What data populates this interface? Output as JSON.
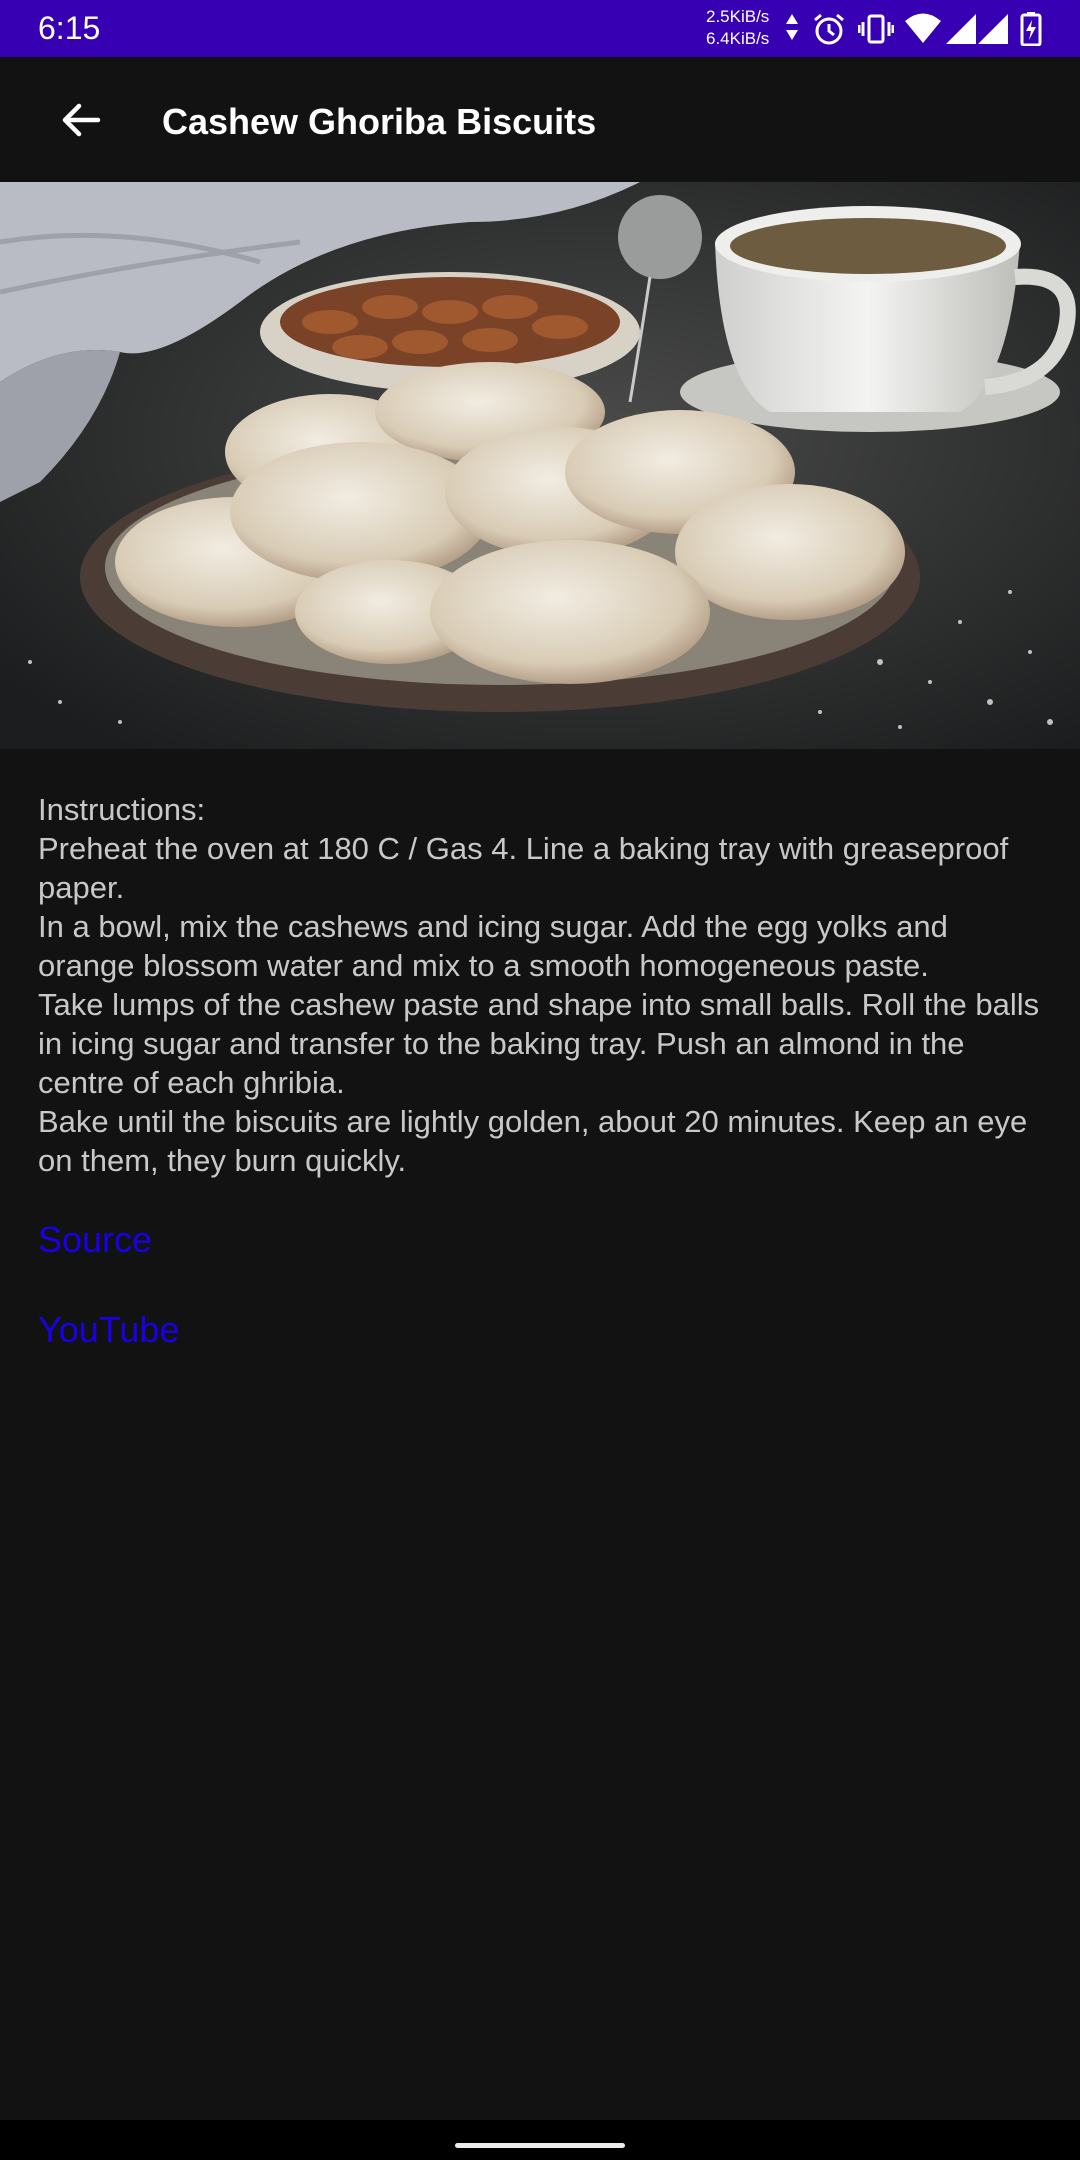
{
  "status_bar": {
    "time": "6:15",
    "upload_speed": "2.5KiB/s",
    "download_speed": "6.4KiB/s",
    "background_color": "#3700b3",
    "icons": [
      "data-arrows-icon",
      "alarm-icon",
      "vibrate-icon",
      "wifi-icon",
      "signal-icon",
      "signal-icon",
      "battery-charging-icon"
    ]
  },
  "app_bar": {
    "title": "Cashew Ghoriba Biscuits",
    "back_icon": "arrow-back-icon"
  },
  "recipe": {
    "instructions": "Instructions:\nPreheat the oven at 180 C / Gas 4. Line a baking tray with greaseproof paper.\nIn a bowl, mix the cashews and icing sugar. Add the egg yolks and orange blossom water and mix to a smooth homogeneous paste.\nTake lumps of the cashew paste and shape into small balls. Roll the balls in icing sugar and transfer to the baking tray. Push an almond in the centre of each ghribia.\nBake until the biscuits are lightly golden, about 20 minutes. Keep an eye on them, they burn quickly.",
    "links": {
      "source": "Source",
      "youtube": "YouTube"
    },
    "link_color": "#1a00e6"
  }
}
